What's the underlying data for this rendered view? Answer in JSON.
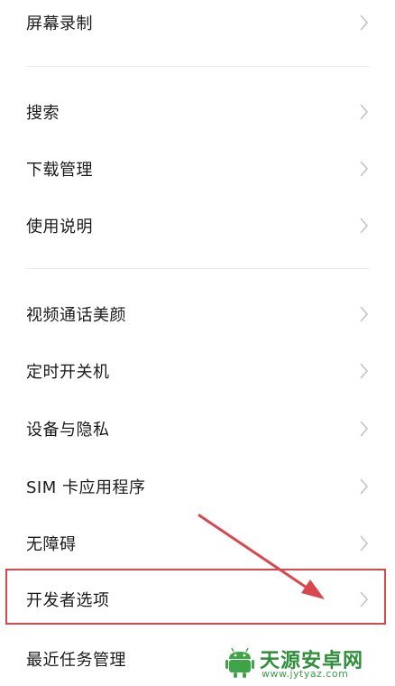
{
  "settings": {
    "items": [
      {
        "label": "屏幕录制"
      },
      {
        "label": "搜索"
      },
      {
        "label": "下载管理"
      },
      {
        "label": "使用说明"
      },
      {
        "label": "视频通话美颜"
      },
      {
        "label": "定时开关机"
      },
      {
        "label": "设备与隐私"
      },
      {
        "label": "SIM 卡应用程序"
      },
      {
        "label": "无障碍"
      },
      {
        "label": "开发者选项"
      },
      {
        "label": "最近任务管理"
      }
    ],
    "chevron_icon": "chevron-right-icon",
    "highlighted_item": "开发者选项"
  },
  "annotation": {
    "highlight_color": "#d9484f",
    "arrow_color": "#d9484f"
  },
  "watermark": {
    "title": "天源安卓网",
    "url": "www.jytyaz.com",
    "color": "#2f8f3a"
  }
}
